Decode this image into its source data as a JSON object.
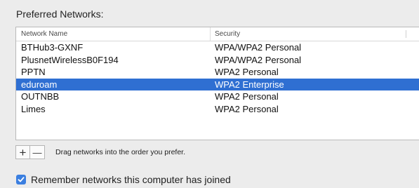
{
  "preferred_networks": {
    "title": "Preferred Networks:",
    "columns": {
      "name": "Network Name",
      "security": "Security"
    },
    "rows": [
      {
        "name": "BTHub3-GXNF",
        "security": "WPA/WPA2 Personal",
        "selected": false
      },
      {
        "name": "PlusnetWirelessB0F194",
        "security": "WPA/WPA2 Personal",
        "selected": false
      },
      {
        "name": "PPTN",
        "security": "WPA2 Personal",
        "selected": false
      },
      {
        "name": "eduroam",
        "security": "WPA2 Enterprise",
        "selected": true
      },
      {
        "name": "OUTNBB",
        "security": "WPA2 Personal",
        "selected": false
      },
      {
        "name": "Limes",
        "security": "WPA2 Personal",
        "selected": false
      },
      {
        "name": "",
        "security": "",
        "selected": false
      }
    ]
  },
  "controls": {
    "add_label": "+",
    "remove_label": "—",
    "hint": "Drag networks into the order you prefer."
  },
  "remember": {
    "label": "Remember networks this computer has joined",
    "checked": true
  },
  "colors": {
    "selection": "#2f6fd2",
    "checkbox": "#3b7fe0",
    "window_bg": "#ececec"
  }
}
